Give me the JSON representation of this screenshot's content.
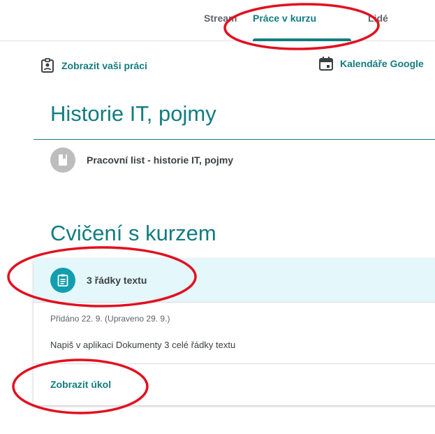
{
  "tabs": [
    "Stream",
    "Práce v kurzu",
    "Lidé"
  ],
  "toolbar": {
    "view_work_label": "Zobrazit vaši práci",
    "calendar_label": "Kalendáře Google"
  },
  "sections": [
    {
      "title": "Historie IT, pojmy",
      "item_title": "Pracovní list - historie IT, pojmy"
    },
    {
      "title": "Cvičení s kurzem",
      "item_title": "3 řádky textu",
      "item_meta": "Přidáno 22. 9. (Upraveno 29. 9.)",
      "item_description": "Napiš v aplikaci Dokumenty 3 celé řádky textu",
      "item_action": "Zobrazit úkol"
    }
  ],
  "colors": {
    "accent": "#137c80",
    "annotation": "#e2101f",
    "card_header_bg": "#e4f7fb",
    "assignment_icon_bg": "#129eaf",
    "material_icon_bg": "#bdbdbd"
  }
}
